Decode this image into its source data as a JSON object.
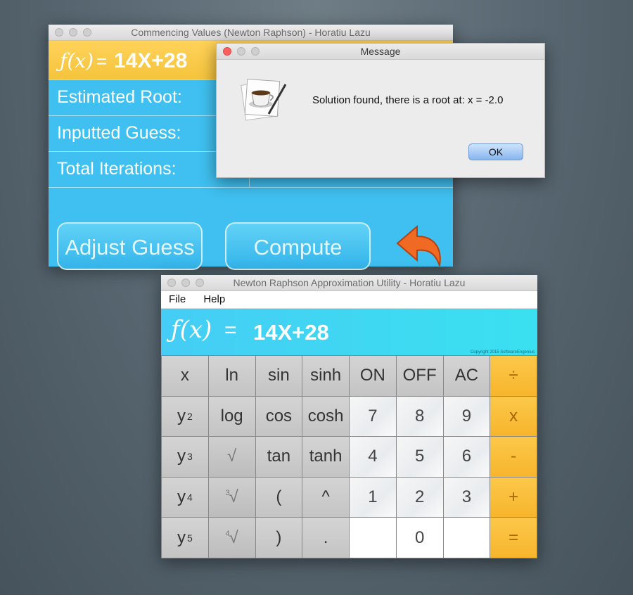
{
  "window1": {
    "title": "Commencing Values (Newton Raphson) - Horatiu Lazu",
    "fx_symbol": "ƒ(x)",
    "eq": "=",
    "function": "14X+28",
    "rows": [
      {
        "label": "Estimated Root:"
      },
      {
        "label": "Inputted Guess:"
      },
      {
        "label": "Total Iterations:"
      }
    ],
    "adjust_label": "Adjust Guess",
    "compute_label": "Compute",
    "accent": "#3fc0f0",
    "header_color": "#ffd25a"
  },
  "dialog": {
    "title": "Message",
    "message": "Solution found, there is a root at: x = -2.0",
    "ok_label": "OK"
  },
  "calculator": {
    "title": "Newton Raphson Approximation Utility - Horatiu Lazu",
    "menu": [
      "File",
      "Help"
    ],
    "fx_symbol": "ƒ(x)",
    "eq": "=",
    "function": "14X+28",
    "copyright": "Copyright 2015 SoftwareEngenius",
    "keys": [
      [
        "x",
        "ln",
        "sin",
        "sinh",
        "ON",
        "OFF",
        "AC",
        "÷"
      ],
      [
        "y",
        "log",
        "cos",
        "cosh",
        "7",
        "8",
        "9",
        "x"
      ],
      [
        "y",
        "√",
        "tan",
        "tanh",
        "4",
        "5",
        "6",
        "-"
      ],
      [
        "y",
        "√",
        "(",
        "^",
        "1",
        "2",
        "3",
        "+"
      ],
      [
        "y",
        "√",
        ")",
        ".",
        "",
        "0",
        "",
        "="
      ]
    ],
    "sup": {
      "r1": "2",
      "r2": "3",
      "r3": "4",
      "r4": "5",
      "cube": "3",
      "fourth": "4"
    }
  }
}
